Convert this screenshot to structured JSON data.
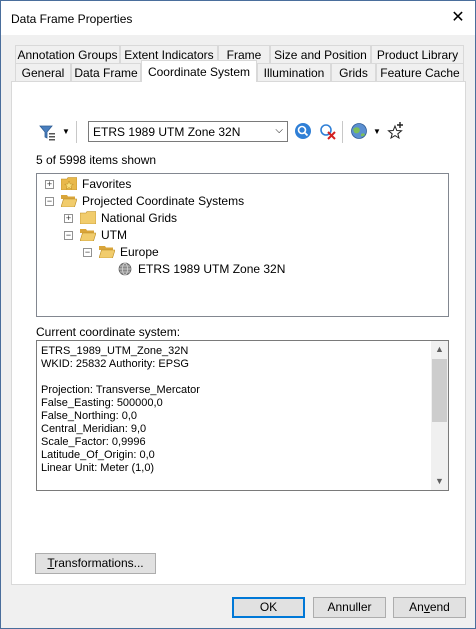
{
  "window": {
    "title": "Data Frame Properties",
    "close_glyph": "✕"
  },
  "tabs": {
    "row1": [
      "Annotation Groups",
      "Extent Indicators",
      "Frame",
      "Size and Position",
      "Product Library"
    ],
    "row2": [
      "General",
      "Data Frame",
      "Coordinate System",
      "Illumination",
      "Grids",
      "Feature Cache"
    ],
    "active": "Coordinate System"
  },
  "toolbar": {
    "icons": [
      "filter-icon",
      "dropdown-arrow-icon",
      "search-icon",
      "clear-search-icon",
      "globe-icon",
      "add-favorite-icon"
    ]
  },
  "search": {
    "value": "ETRS 1989 UTM Zone 32N",
    "arrow": "⌵"
  },
  "count_text": "5 of 5998 items shown",
  "tree": {
    "items": [
      {
        "label": "Favorites",
        "expander": "+",
        "level": 0,
        "icon": "favorites-folder-icon"
      },
      {
        "label": "Projected Coordinate Systems",
        "expander": "−",
        "level": 0,
        "icon": "open-folder-icon"
      },
      {
        "label": "National Grids",
        "expander": "+",
        "level": 1,
        "icon": "folder-icon"
      },
      {
        "label": "UTM",
        "expander": "−",
        "level": 1,
        "icon": "open-folder-icon"
      },
      {
        "label": "Europe",
        "expander": "−",
        "level": 2,
        "icon": "open-folder-icon"
      },
      {
        "label": "ETRS 1989 UTM Zone 32N",
        "expander": "",
        "level": 3,
        "icon": "globe-icon"
      }
    ]
  },
  "current_label": "Current coordinate system:",
  "coord_details": [
    "ETRS_1989_UTM_Zone_32N",
    "WKID: 25832 Authority: EPSG",
    "",
    "Projection: Transverse_Mercator",
    "False_Easting: 500000,0",
    "False_Northing: 0,0",
    "Central_Meridian: 9,0",
    "Scale_Factor: 0,9996",
    "Latitude_Of_Origin: 0,0",
    "Linear Unit: Meter (1,0)"
  ],
  "buttons": {
    "transformations_u": "T",
    "transformations_rest": "ransformations...",
    "ok": "OK",
    "cancel": "Annuller",
    "apply_pre": "An",
    "apply_u": "v",
    "apply_post": "end"
  },
  "colors": {
    "accent": "#0078d7",
    "folder": "#e8b84a"
  }
}
